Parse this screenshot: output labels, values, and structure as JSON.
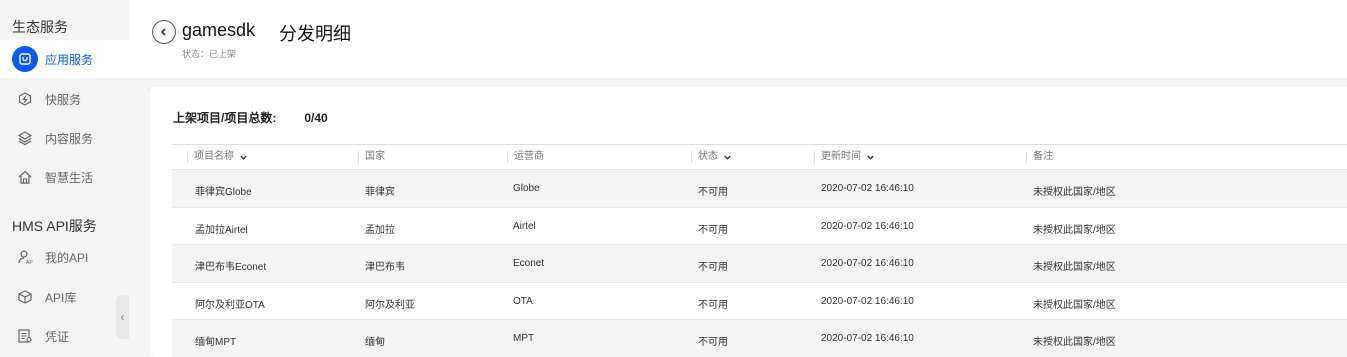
{
  "sidebar": {
    "group1": "生态服务",
    "group2": "HMS API服务",
    "items": [
      {
        "label": "应用服务",
        "icon": "app-store-icon"
      },
      {
        "label": "快服务",
        "icon": "quick-app-icon"
      },
      {
        "label": "内容服务",
        "icon": "layers-icon"
      },
      {
        "label": "智慧生活",
        "icon": "home-icon"
      },
      {
        "label": "我的API",
        "icon": "user-api-icon"
      },
      {
        "label": "API库",
        "icon": "cube-icon"
      },
      {
        "label": "凭证",
        "icon": "credential-icon"
      }
    ]
  },
  "header": {
    "app_name": "gamesdk",
    "title": "分发明细",
    "status": "状态：已上架"
  },
  "summary": {
    "label": "上架项目/项目总数:",
    "value": "0/40"
  },
  "table": {
    "columns": [
      "项目名称",
      "国家",
      "运营商",
      "状态",
      "更新时间",
      "备注"
    ],
    "rows": [
      [
        "菲律宾Globe",
        "菲律宾",
        "Globe",
        "不可用",
        "2020-07-02 16:46:10",
        "未授权此国家/地区"
      ],
      [
        "孟加拉Airtel",
        "孟加拉",
        "Airtel",
        "不可用",
        "2020-07-02 16:46:10",
        "未授权此国家/地区"
      ],
      [
        "津巴布韦Econet",
        "津巴布韦",
        "Econet",
        "不可用",
        "2020-07-02 16:46:10",
        "未授权此国家/地区"
      ],
      [
        "阿尔及利亚OTA",
        "阿尔及利亚",
        "OTA",
        "不可用",
        "2020-07-02 16:46:10",
        "未授权此国家/地区"
      ],
      [
        "缅甸MPT",
        "缅甸",
        "MPT",
        "不可用",
        "2020-07-02 16:46:10",
        "未授权此国家/地区"
      ]
    ]
  },
  "colors": {
    "accent": "#0a59f7"
  }
}
